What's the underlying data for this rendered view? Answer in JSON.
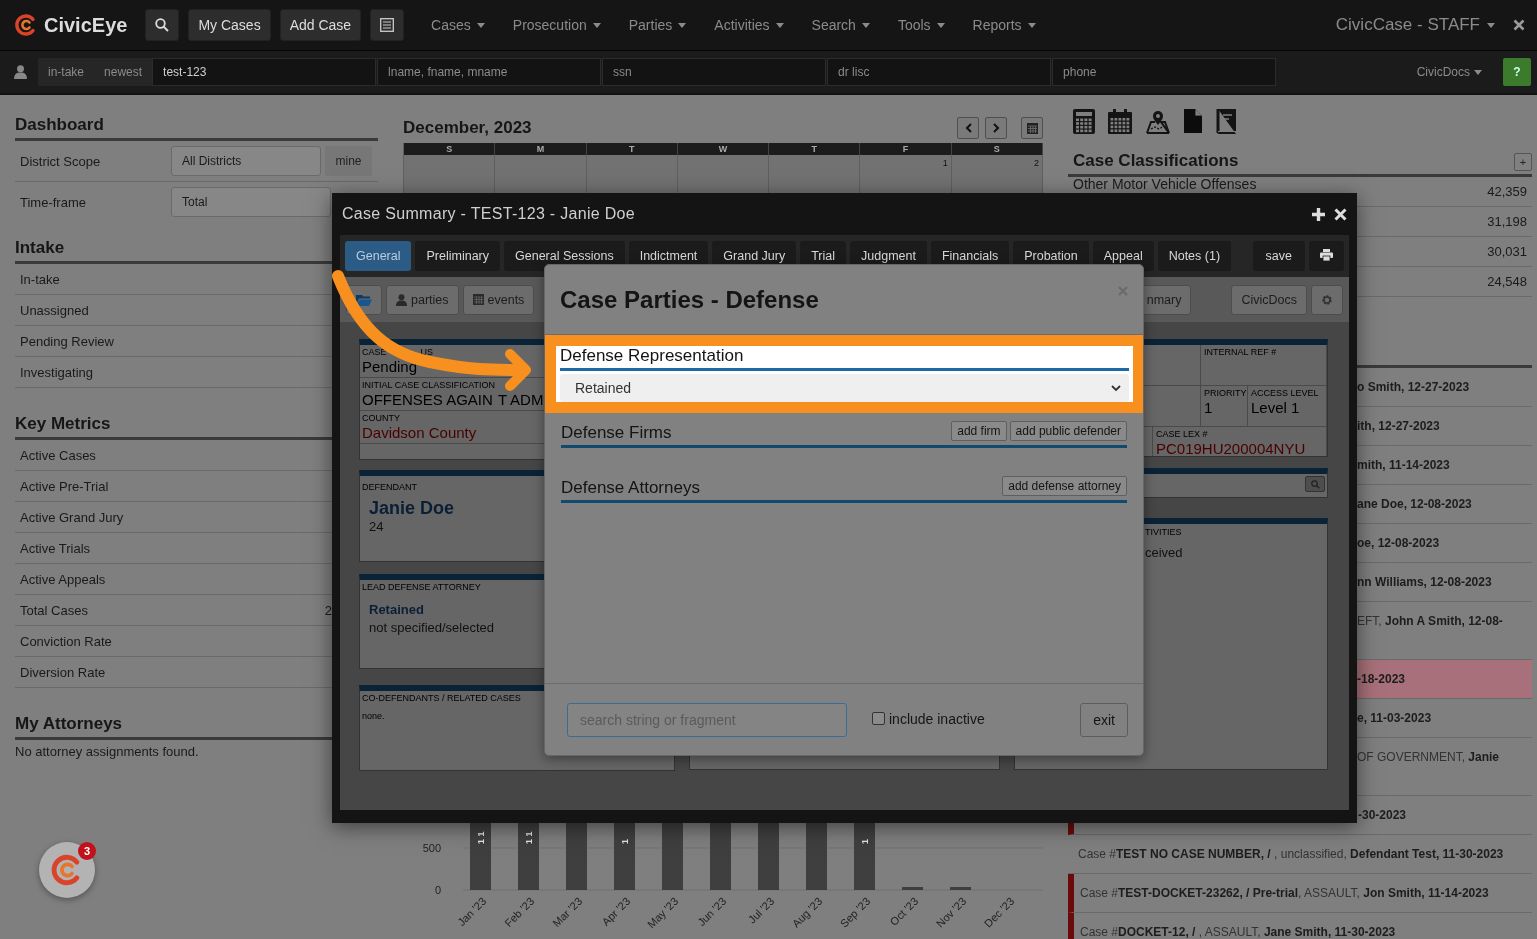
{
  "top_nav": {
    "brand": "CivicEye",
    "buttons": [
      "My Cases",
      "Add Case"
    ],
    "menus": [
      "Cases",
      "Prosecution",
      "Parties",
      "Activities",
      "Search",
      "Tools",
      "Reports"
    ],
    "app_menu": "CivicCase - STAFF"
  },
  "search_bar": {
    "filters": [
      "in-take",
      "newest"
    ],
    "fields": [
      {
        "value": "test-123"
      },
      {
        "placeholder": "lname, fname, mname"
      },
      {
        "placeholder": "ssn"
      },
      {
        "placeholder": "dr lisc"
      },
      {
        "placeholder": "phone"
      }
    ],
    "docs_menu": "CivicDocs",
    "help": "?"
  },
  "dashboard": {
    "title": "Dashboard",
    "district_scope": {
      "label": "District Scope",
      "value": "All Districts",
      "button": "mine"
    },
    "time_frame": {
      "label": "Time-frame",
      "value": "Total"
    }
  },
  "intake": {
    "title": "Intake",
    "items": [
      {
        "label": "In-take"
      },
      {
        "label": "Unassigned"
      },
      {
        "label": "Pending Review"
      },
      {
        "label": "Investigating"
      }
    ]
  },
  "key_metrics": {
    "title": "Key Metrics",
    "items": [
      {
        "label": "Active Cases"
      },
      {
        "label": "Active Pre-Trial"
      },
      {
        "label": "Active Grand Jury"
      },
      {
        "label": "Active Trials"
      },
      {
        "label": "Active Appeals"
      },
      {
        "label": "Total Cases",
        "value": "2"
      },
      {
        "label": "Conviction Rate"
      },
      {
        "label": "Diversion Rate"
      }
    ]
  },
  "attorneys": {
    "title": "My Attorneys",
    "empty_text": "No attorney assignments found."
  },
  "calendar": {
    "title": "December, 2023",
    "weekdays": [
      "S",
      "M",
      "T",
      "W",
      "T",
      "F",
      "S"
    ],
    "first_week_days": [
      "1",
      "2"
    ]
  },
  "chart": {
    "yticks": [
      "500",
      "0"
    ],
    "months": [
      {
        "label": "Jan '23",
        "kind": "tall",
        "bar_label": "1 1"
      },
      {
        "label": "Feb '23",
        "kind": "tall",
        "bar_label": "1 1"
      },
      {
        "label": "Mar '23",
        "kind": "tall"
      },
      {
        "label": "Apr '23",
        "kind": "tall",
        "bar_label": "1"
      },
      {
        "label": "May '23",
        "kind": "tall"
      },
      {
        "label": "Jun '23",
        "kind": "tall"
      },
      {
        "label": "Jul '23",
        "kind": "tall"
      },
      {
        "label": "Aug '23",
        "kind": "tall"
      },
      {
        "label": "Sep '23",
        "kind": "tall",
        "bar_label": "1"
      },
      {
        "label": "Oct '23",
        "kind": "low"
      },
      {
        "label": "Nov '23",
        "kind": "low"
      },
      {
        "label": "Dec '23",
        "kind": "none"
      }
    ]
  },
  "right_panel": {
    "classifications": {
      "title": "Case Classifications",
      "add": "+",
      "rows": [
        {
          "label": "Other Motor Vehicle Offenses",
          "count": "42,359"
        },
        {
          "count": "31,198"
        },
        {
          "count": "30,031"
        },
        {
          "count": "24,548"
        }
      ]
    },
    "recent_cases": [
      {
        "text": "**o Smith, 12-27-2023**",
        "kind": "single",
        "flagged": false,
        "highlighted": false
      },
      {
        "text": "**ith, 12-27-2023**",
        "kind": "single",
        "flagged": false,
        "highlighted": false
      },
      {
        "text": "**mith, 11-14-2023**",
        "kind": "single",
        "flagged": false,
        "highlighted": false
      },
      {
        "text": "**ane Doe, 12-08-2023**",
        "kind": "single",
        "flagged": false,
        "highlighted": false
      },
      {
        "text": "**oe, 12-08-2023**",
        "kind": "single",
        "flagged": false,
        "highlighted": false
      },
      {
        "text": "**nn Williams, 12-08-2023**",
        "kind": "single",
        "flagged": false,
        "highlighted": false
      },
      {
        "text": "EFT, **John A Smith, 12-08-**",
        "kind": "wrapped",
        "flagged": false,
        "highlighted": false
      },
      {
        "text": "**-18-2023**",
        "kind": "single",
        "flagged": false,
        "highlighted": true
      },
      {
        "text": "**e, 11-03-2023**",
        "kind": "single",
        "flagged": false,
        "highlighted": false
      },
      {
        "text": "OF GOVERNMENT, **Janie**",
        "kind": "wrapped",
        "flagged": false,
        "highlighted": false
      },
      {
        "text": "**-30-2023**",
        "kind": "single",
        "flagged": true,
        "highlighted": false
      },
      {
        "text": "Case #**TEST NO CASE NUMBER, /** , unclassified, **Defendant Test, 11-30-2023**",
        "kind": "single",
        "flagged": false,
        "highlighted": false
      },
      {
        "text": "Case #**TEST-DOCKET-23262, / Pre-trial**, ASSAULT, **Jon Smith, 11-14-2023**",
        "kind": "single",
        "flagged": true,
        "highlighted": false
      },
      {
        "text": "Case #**DOCKET-12, /** , ASSAULT, **Jane Smith, 11-30-2023**",
        "kind": "single",
        "flagged": true,
        "highlighted": false
      }
    ]
  },
  "case_summary": {
    "title": "Case Summary - TEST-123 - Janie Doe",
    "tabs": [
      {
        "label": "General",
        "selected": true
      },
      {
        "label": "Preliminary",
        "selected": false
      },
      {
        "label": "General Sessions",
        "selected": false
      },
      {
        "label": "Indictment",
        "selected": false
      },
      {
        "label": "Grand Jury",
        "selected": false
      },
      {
        "label": "Trial",
        "selected": false
      },
      {
        "label": "Judgment",
        "selected": false
      },
      {
        "label": "Financials",
        "selected": false
      },
      {
        "label": "Probation",
        "selected": false
      },
      {
        "label": "Appeal",
        "selected": false
      },
      {
        "label": "Notes (1)",
        "selected": false
      }
    ],
    "save": "save",
    "toolbar": [
      {
        "kind": "folder"
      },
      {
        "kind": "person",
        "label": "parties"
      },
      {
        "kind": "calendar",
        "label": "events"
      }
    ],
    "toolbar_fragment": "nmary",
    "docs": "CivicDocs",
    "status_panel": [
      {
        "label": "CASE",
        "label_tail": "US",
        "value": "Pending",
        "kind": "plain"
      },
      {
        "label": "INITIAL CASE CLASSIFICATION",
        "value": "OFFENSES AGAIN",
        "value_tail": "T ADM",
        "kind": "plain"
      },
      {
        "label": "COUNTY",
        "value": "Davidson County",
        "kind": "alert"
      }
    ],
    "defendant": {
      "label": "DEFENDANT",
      "name": "Janie Doe",
      "age": "24"
    },
    "lead_attorney": {
      "label": "LEAD DEFENSE ATTORNEY",
      "type": "Retained",
      "name": "not specified/selected"
    },
    "codefendants": {
      "label": "CO-DEFENDANTS / RELATED CASES",
      "value": "none."
    },
    "reference": {
      "internal_ref": "INTERNAL REF #",
      "priority": {
        "label": "PRIORITY",
        "value": "1"
      },
      "access_level": {
        "label": "ACCESS LEVEL",
        "value": "Level 1"
      },
      "case_lex": {
        "label": "CASE LEX #",
        "value": "PC019HU200004NYU"
      }
    },
    "activities": {
      "label": "TIVITIES",
      "value": "ceived"
    }
  },
  "defense_dialog": {
    "title": "Case Parties - Defense",
    "representation": {
      "title": "Defense Representation",
      "value": "Retained",
      "highlighted": true
    },
    "sections": [
      {
        "title": "Defense Firms",
        "buttons": [
          "add firm",
          "add public defender"
        ]
      },
      {
        "title": "Defense Attorneys",
        "buttons": [
          "add defense attorney"
        ]
      }
    ],
    "search": {
      "placeholder": "search string or fragment"
    },
    "include_inactive": {
      "label": "include inactive",
      "checked": false
    },
    "exit": "exit"
  },
  "chat_badge": "3"
}
